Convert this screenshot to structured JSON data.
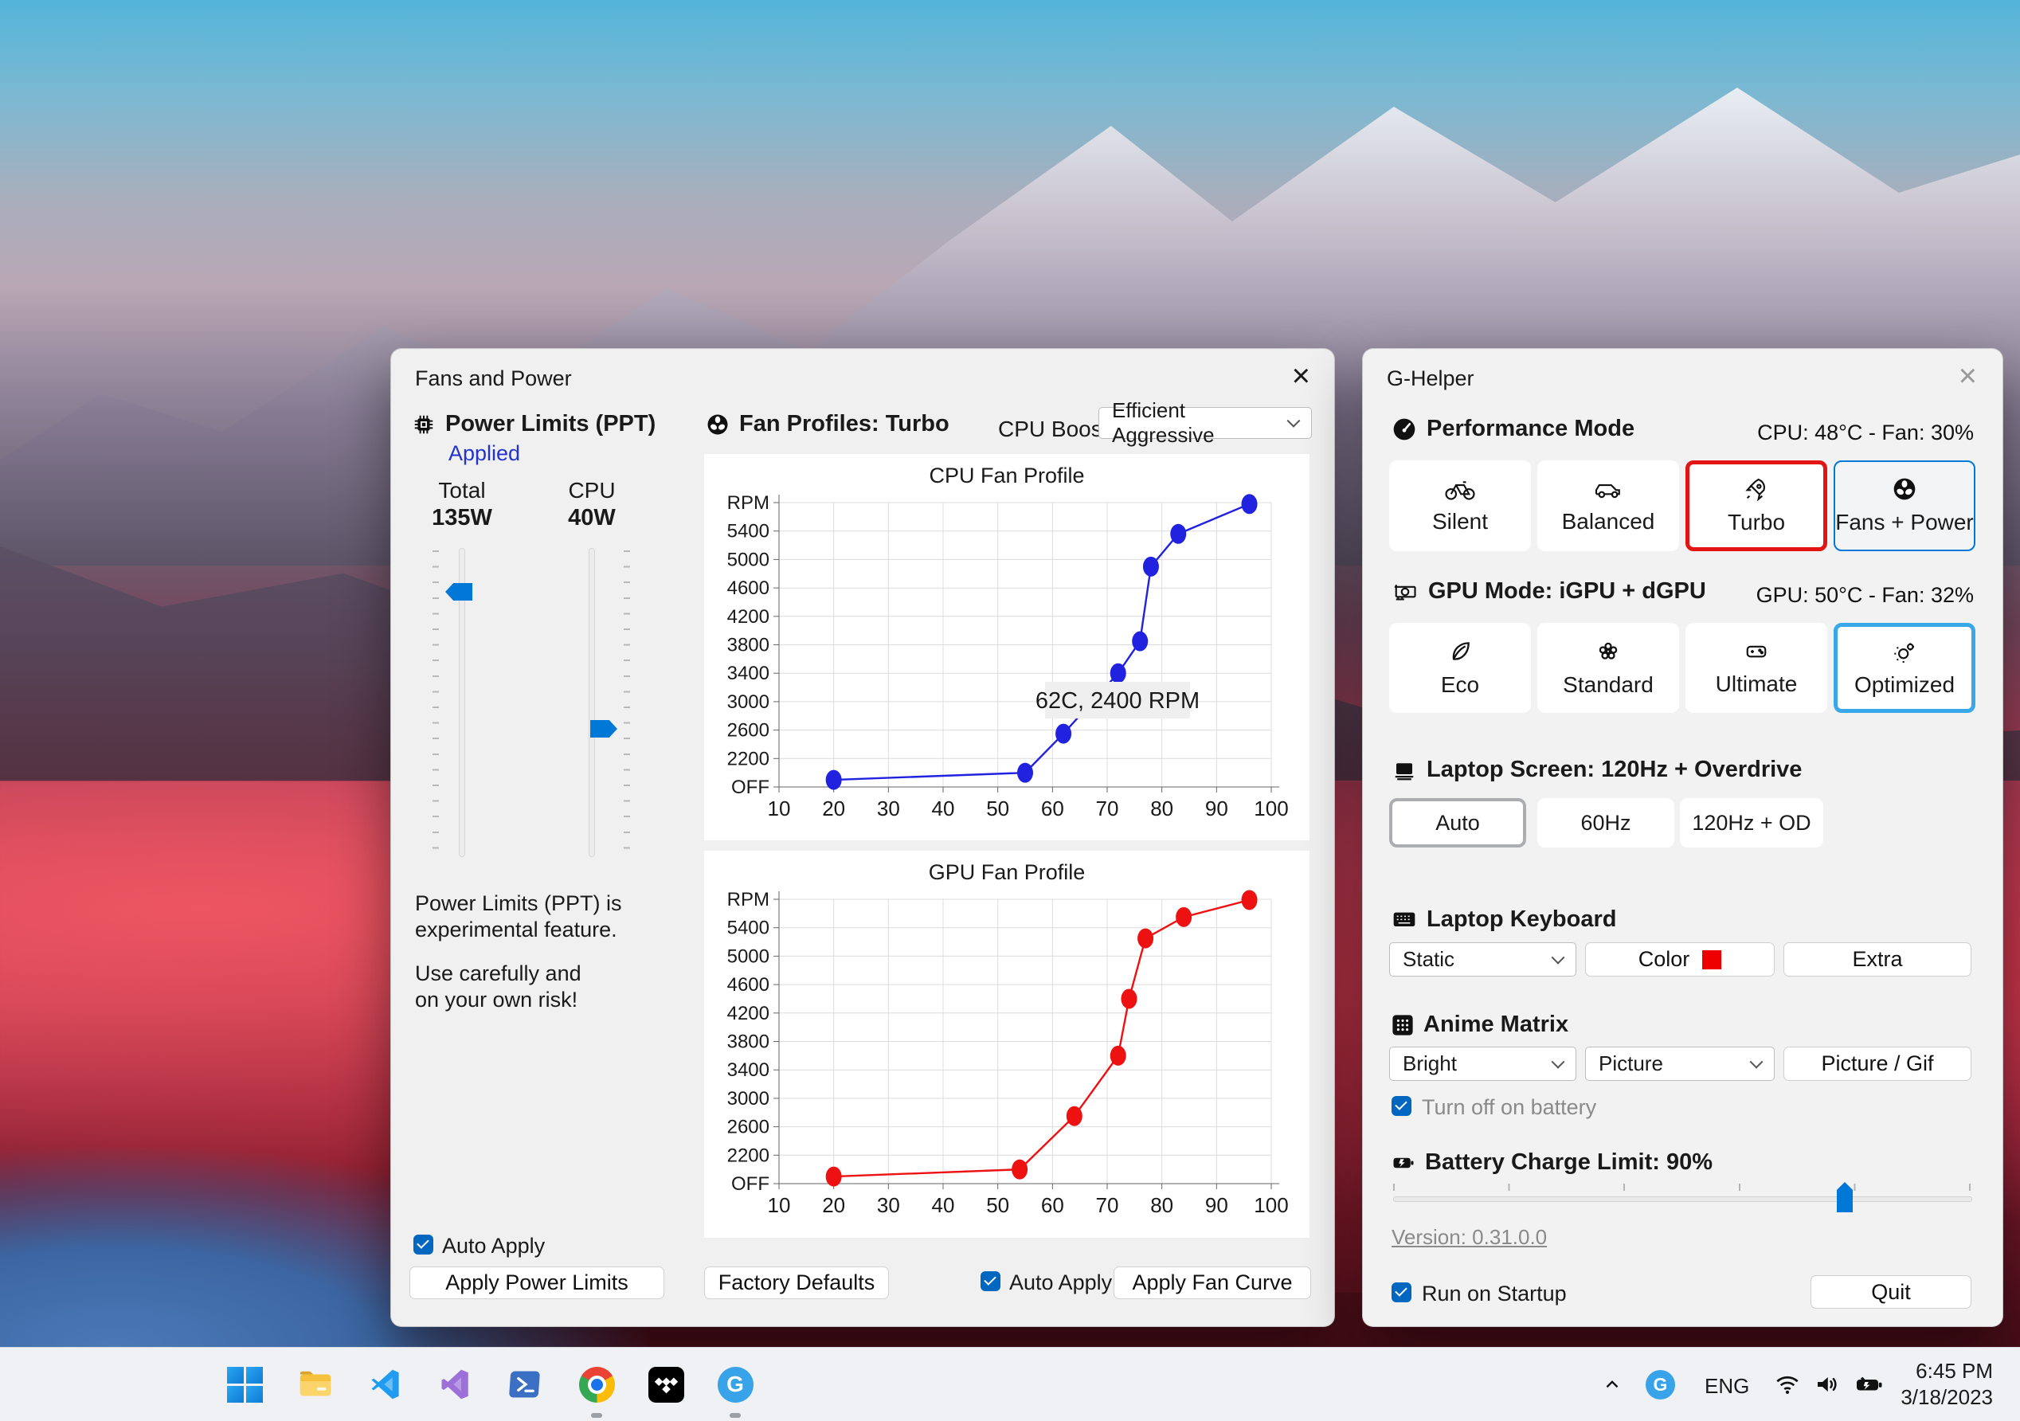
{
  "fans_window": {
    "title": "Fans and Power",
    "close_glyph": "×",
    "power_limits": {
      "header": "Power Limits (PPT)",
      "status_link": "Applied",
      "total_label": "Total",
      "total_value": "135W",
      "cpu_label": "CPU",
      "cpu_value": "40W",
      "total_percent": 12,
      "cpu_percent": 59,
      "warning_1": "Power Limits (PPT) is\nexperimental feature.",
      "warning_2": "Use carefully and\non your own risk!",
      "auto_apply_label": "Auto Apply",
      "apply_button": "Apply Power Limits"
    },
    "fan_profiles": {
      "header": "Fan Profiles: Turbo",
      "cpu_boost_label": "CPU Boost",
      "cpu_boost_value": "Efficient Aggressive",
      "factory_defaults_button": "Factory Defaults",
      "auto_apply_label": "Auto Apply",
      "apply_button": "Apply Fan Curve"
    }
  },
  "chart_data": [
    {
      "type": "line",
      "title": "CPU Fan Profile",
      "x": [
        20,
        55,
        62,
        72,
        76,
        78,
        83,
        96
      ],
      "y": [
        1900,
        2000,
        2550,
        3400,
        3850,
        4900,
        5360,
        5780
      ],
      "xlim": [
        10,
        100
      ],
      "ylim": [
        1800,
        5800
      ],
      "xticks": [
        10,
        20,
        30,
        40,
        50,
        60,
        70,
        80,
        90,
        100
      ],
      "ytick_step": 400,
      "ytick_labels": [
        "OFF",
        "2200",
        "2600",
        "3000",
        "3400",
        "3800",
        "4200",
        "4600",
        "5000",
        "5400",
        "RPM"
      ],
      "grid": true,
      "legend": "none",
      "color": "#2121e0",
      "tooltip": "62C, 2400 RPM"
    },
    {
      "type": "line",
      "title": "GPU Fan Profile",
      "x": [
        20,
        54,
        64,
        72,
        74,
        77,
        84,
        96
      ],
      "y": [
        1900,
        2000,
        2750,
        3600,
        4400,
        5250,
        5550,
        5790
      ],
      "xlim": [
        10,
        100
      ],
      "ylim": [
        1800,
        5800
      ],
      "xticks": [
        10,
        20,
        30,
        40,
        50,
        60,
        70,
        80,
        90,
        100
      ],
      "ytick_step": 400,
      "ytick_labels": [
        "OFF",
        "2200",
        "2600",
        "3000",
        "3400",
        "3800",
        "4200",
        "4600",
        "5000",
        "5400",
        "RPM"
      ],
      "grid": true,
      "legend": "none",
      "color": "#ee1111",
      "tooltip": null
    }
  ],
  "ghelper_window": {
    "title": "G-Helper",
    "close_glyph": "×",
    "performance": {
      "header": "Performance Mode",
      "status": "CPU: 48°C -  Fan: 30%",
      "buttons": [
        {
          "label": "Silent"
        },
        {
          "label": "Balanced"
        },
        {
          "label": "Turbo"
        },
        {
          "label": "Fans + Power"
        }
      ]
    },
    "gpu_mode": {
      "header": "GPU Mode: iGPU + dGPU",
      "status": "GPU: 50°C -  Fan: 32%",
      "buttons": [
        {
          "label": "Eco"
        },
        {
          "label": "Standard"
        },
        {
          "label": "Ultimate"
        },
        {
          "label": "Optimized"
        }
      ]
    },
    "screen": {
      "header": "Laptop Screen: 120Hz + Overdrive",
      "buttons": [
        {
          "label": "Auto"
        },
        {
          "label": "60Hz"
        },
        {
          "label": "120Hz + OD"
        }
      ]
    },
    "keyboard": {
      "header": "Laptop Keyboard",
      "mode_value": "Static",
      "color_button": "Color",
      "swatch_color": "#ee0000",
      "extra_button": "Extra"
    },
    "anime_matrix": {
      "header": "Anime Matrix",
      "brightness_value": "Bright",
      "mode_value": "Picture",
      "picture_button": "Picture / Gif",
      "battery_checkbox_label": "Turn off on battery"
    },
    "battery": {
      "header": "Battery Charge Limit: 90%",
      "slider_percent": 78
    },
    "version_link": "Version: 0.31.0.0",
    "startup_checkbox_label": "Run on Startup",
    "quit_button": "Quit"
  },
  "taskbar": {
    "tray_language": "ENG",
    "tray_time": "6:45 PM",
    "tray_date": "3/18/2023"
  },
  "colors": {
    "accent_blue": "#0067c0",
    "slider_blue": "#0078d7",
    "selected_red": "#e31414",
    "selected_blue": "#38a8e8",
    "chart_blue": "#2121e0",
    "chart_red": "#ee1111"
  }
}
